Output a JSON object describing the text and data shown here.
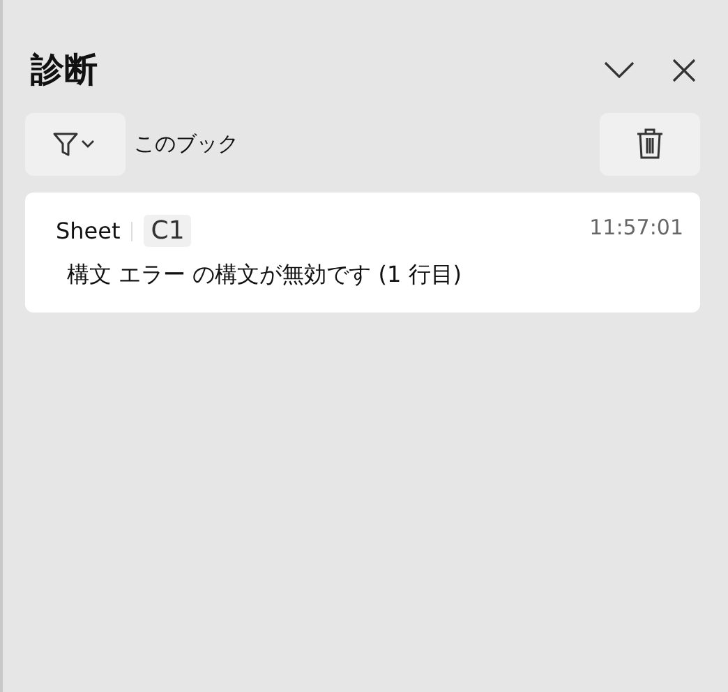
{
  "panel": {
    "title": "診断"
  },
  "toolbar": {
    "scope": "このブック"
  },
  "entries": [
    {
      "sheet": "Sheet",
      "cell": "C1",
      "time": "11:57:01",
      "message": "構文 エラー の構文が無効です (1 行目)"
    }
  ]
}
